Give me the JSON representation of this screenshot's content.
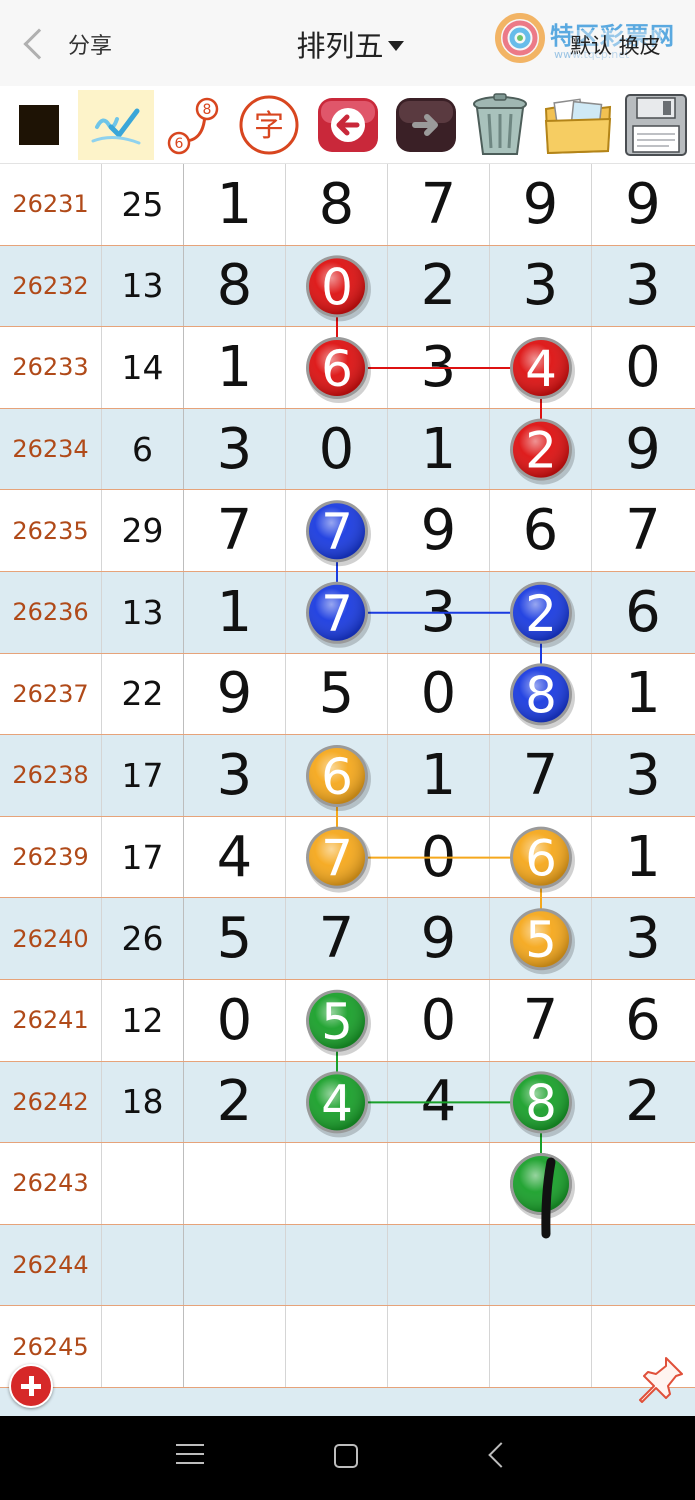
{
  "header": {
    "back_label": "分享",
    "title": "排列五",
    "logo_text": "特区彩票网",
    "logo_subtext": "www.tqcp.net",
    "action_label": "默认 换皮"
  },
  "toolbar": {
    "tools": [
      "color-picker",
      "pen",
      "line-tool",
      "text-tool",
      "undo",
      "redo",
      "clear-trash",
      "background-image",
      "save"
    ],
    "line_tool_numbers": [
      "8",
      "6"
    ],
    "text_tool_glyph": "字",
    "selected_color": "#1e1305",
    "selected_tool": "pen"
  },
  "rows": [
    {
      "issue": "26231",
      "sum": "25",
      "digits": [
        "1",
        "8",
        "7",
        "9",
        "9"
      ]
    },
    {
      "issue": "26232",
      "sum": "13",
      "digits": [
        "8",
        "0",
        "2",
        "3",
        "3"
      ]
    },
    {
      "issue": "26233",
      "sum": "14",
      "digits": [
        "1",
        "6",
        "3",
        "4",
        "0"
      ]
    },
    {
      "issue": "26234",
      "sum": "6",
      "digits": [
        "3",
        "0",
        "1",
        "2",
        "9"
      ]
    },
    {
      "issue": "26235",
      "sum": "29",
      "digits": [
        "7",
        "7",
        "9",
        "6",
        "7"
      ]
    },
    {
      "issue": "26236",
      "sum": "13",
      "digits": [
        "1",
        "7",
        "3",
        "2",
        "6"
      ]
    },
    {
      "issue": "26237",
      "sum": "22",
      "digits": [
        "9",
        "5",
        "0",
        "8",
        "1"
      ]
    },
    {
      "issue": "26238",
      "sum": "17",
      "digits": [
        "3",
        "6",
        "1",
        "7",
        "3"
      ]
    },
    {
      "issue": "26239",
      "sum": "17",
      "digits": [
        "4",
        "7",
        "0",
        "6",
        "1"
      ]
    },
    {
      "issue": "26240",
      "sum": "26",
      "digits": [
        "5",
        "7",
        "9",
        "5",
        "3"
      ]
    },
    {
      "issue": "26241",
      "sum": "12",
      "digits": [
        "0",
        "5",
        "0",
        "7",
        "6"
      ]
    },
    {
      "issue": "26242",
      "sum": "18",
      "digits": [
        "2",
        "4",
        "4",
        "8",
        "2"
      ]
    },
    {
      "issue": "26243",
      "sum": "",
      "digits": [
        "",
        "",
        "",
        "",
        ""
      ]
    },
    {
      "issue": "26244",
      "sum": "",
      "digits": [
        "",
        "",
        "",
        "",
        ""
      ]
    },
    {
      "issue": "26245",
      "sum": "",
      "digits": [
        "",
        "",
        "",
        "",
        ""
      ]
    }
  ],
  "marks": [
    {
      "color": "#dd1111",
      "balls": [
        [
          1,
          1
        ],
        [
          2,
          1
        ],
        [
          2,
          3
        ],
        [
          3,
          3
        ]
      ]
    },
    {
      "color": "#1a3be0",
      "balls": [
        [
          4,
          1
        ],
        [
          5,
          1
        ],
        [
          5,
          3
        ],
        [
          6,
          3
        ]
      ]
    },
    {
      "color": "#f5a81c",
      "balls": [
        [
          7,
          1
        ],
        [
          8,
          1
        ],
        [
          8,
          3
        ],
        [
          9,
          3
        ]
      ]
    },
    {
      "color": "#19a02a",
      "balls": [
        [
          10,
          1
        ],
        [
          11,
          1
        ],
        [
          11,
          3
        ],
        [
          12,
          3
        ]
      ]
    }
  ],
  "colors": {
    "issue_text": "#b04a19",
    "row_alt_bg": "#dcebf2",
    "row_border": "#e6a37a",
    "pen_tool_bg": "#fdf3c9",
    "add_button": "#d62828"
  }
}
